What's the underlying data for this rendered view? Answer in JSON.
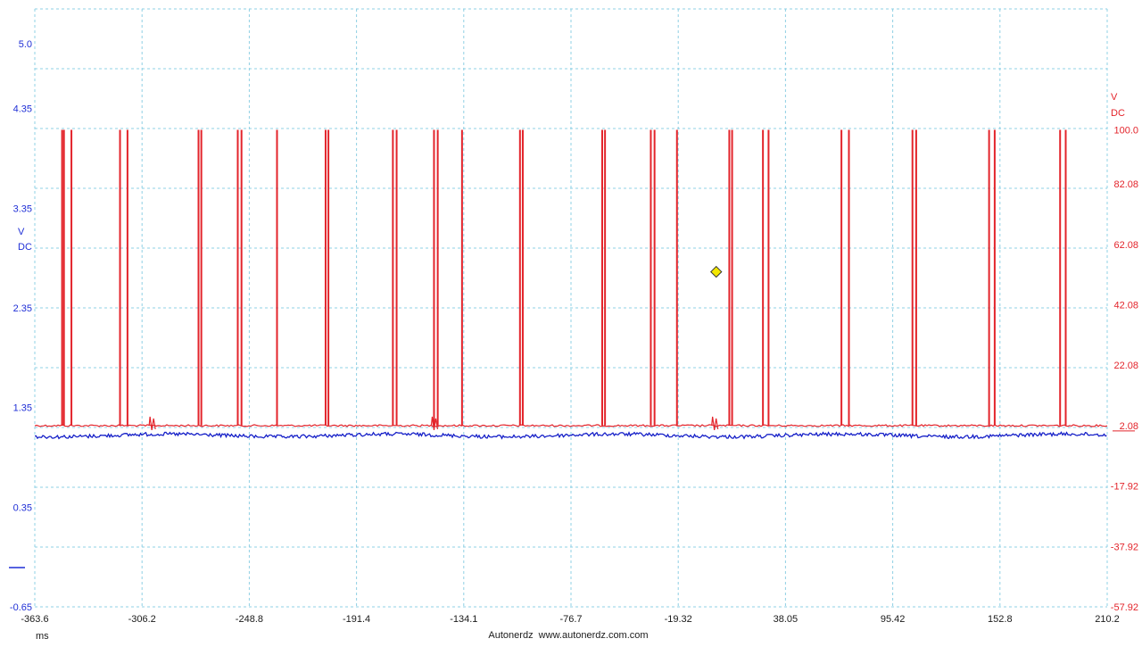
{
  "colors": {
    "left_axis": "#1f2fd6",
    "right_axis": "#e3242b",
    "grid": "#8fd0e4",
    "trace_a": "#e3242b",
    "trace_b": "#1620c8",
    "marker": "#f2e600",
    "footer_text": "#1a1a1a"
  },
  "chart_data": {
    "type": "line",
    "grid": true,
    "x_axis": {
      "unit": "ms",
      "range": [
        -363.6,
        210.2
      ],
      "ticks": [
        "-363.6",
        "-306.2",
        "-248.8",
        "-191.4",
        "-134.1",
        "-76.7",
        "-19.32",
        "38.05",
        "95.42",
        "152.8",
        "210.2"
      ]
    },
    "left_axis": {
      "unit": "V",
      "coupling": "DC",
      "range": [
        -0.65,
        5.0
      ],
      "ticks": [
        "5.0",
        "4.35",
        "3.35",
        "2.35",
        "1.35",
        "0.35",
        "-0.65"
      ]
    },
    "right_axis": {
      "unit": "V",
      "coupling": "DC",
      "range": [
        -57.92,
        100.0
      ],
      "ticks": [
        "100.0",
        "82.08",
        "62.08",
        "42.08",
        "22.08",
        "2.08",
        "-17.92",
        "-37.92",
        "-57.92"
      ]
    },
    "series": [
      {
        "axis": "right",
        "color": "#e3242b",
        "baseline": 2.08,
        "pulse_peak": 100.0,
        "pulse_times_ms": [
          -363.6,
          -349.0,
          -348.0,
          -344.0,
          -318.0,
          -314.0,
          -276.0,
          -274.5,
          -255.0,
          -253.0,
          -234.0,
          -208.0,
          -206.5,
          -172.0,
          -170.0,
          -150.0,
          -148.0,
          -135.0,
          -104.0,
          -102.5,
          -60.0,
          -58.5,
          -34.0,
          -32.0,
          -20.0,
          8.0,
          9.5,
          26.0,
          29.0,
          68.0,
          72.0,
          106.0,
          108.0,
          147.0,
          150.0,
          185.0,
          188.0
        ],
        "small_glitch_times_ms": [
          -301.0,
          -150.0,
          0.0
        ]
      },
      {
        "axis": "left",
        "color": "#1620c8",
        "level_v": 1.07,
        "noise_vpp": 0.12
      }
    ],
    "cursor_marker": {
      "x_ms": 1.0,
      "y_right_v": 53.0
    },
    "footer": "Autonerdz  www.autonerdz.com.com"
  }
}
